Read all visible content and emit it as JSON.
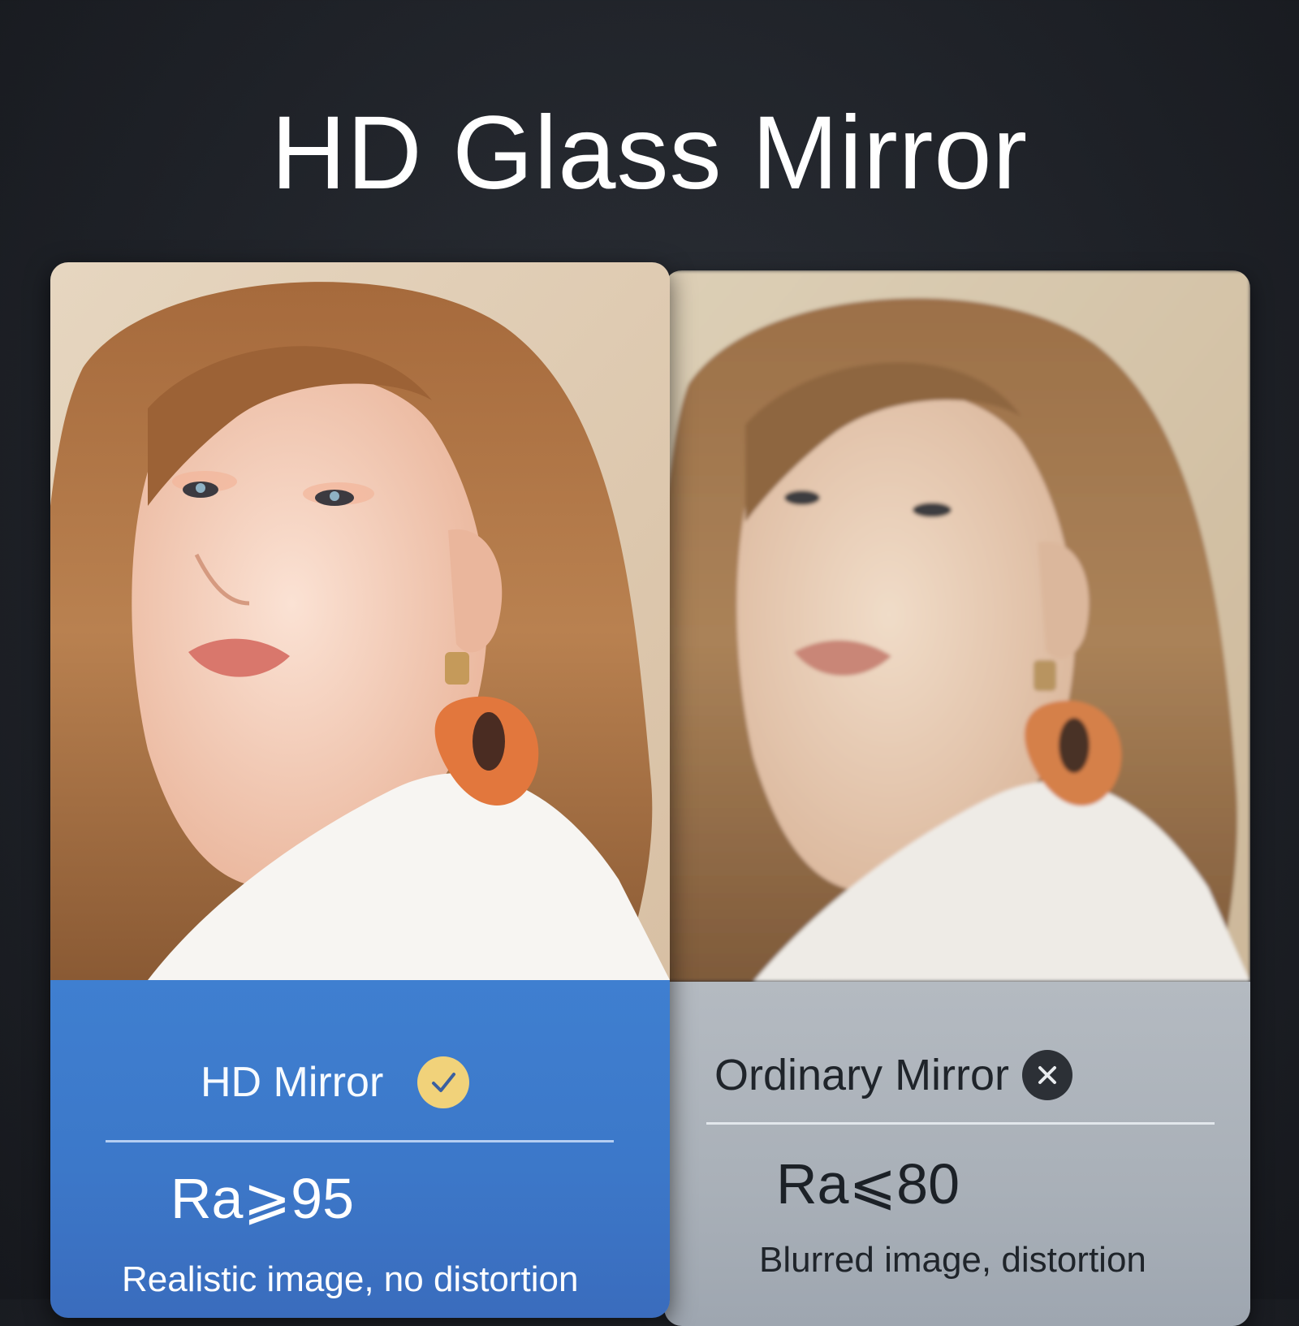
{
  "title": "HD Glass Mirror",
  "hd_card": {
    "label": "HD Mirror",
    "status_icon": "check-circle-icon",
    "ra": "Ra⩾95",
    "description": "Realistic image, no distortion",
    "accent_color": "#3f7fd0"
  },
  "ordinary_card": {
    "label": "Ordinary Mirror",
    "status_icon": "x-circle-icon",
    "ra": "Ra⩽80",
    "description": "Blurred image, distortion",
    "accent_color": "#b4bac1"
  }
}
